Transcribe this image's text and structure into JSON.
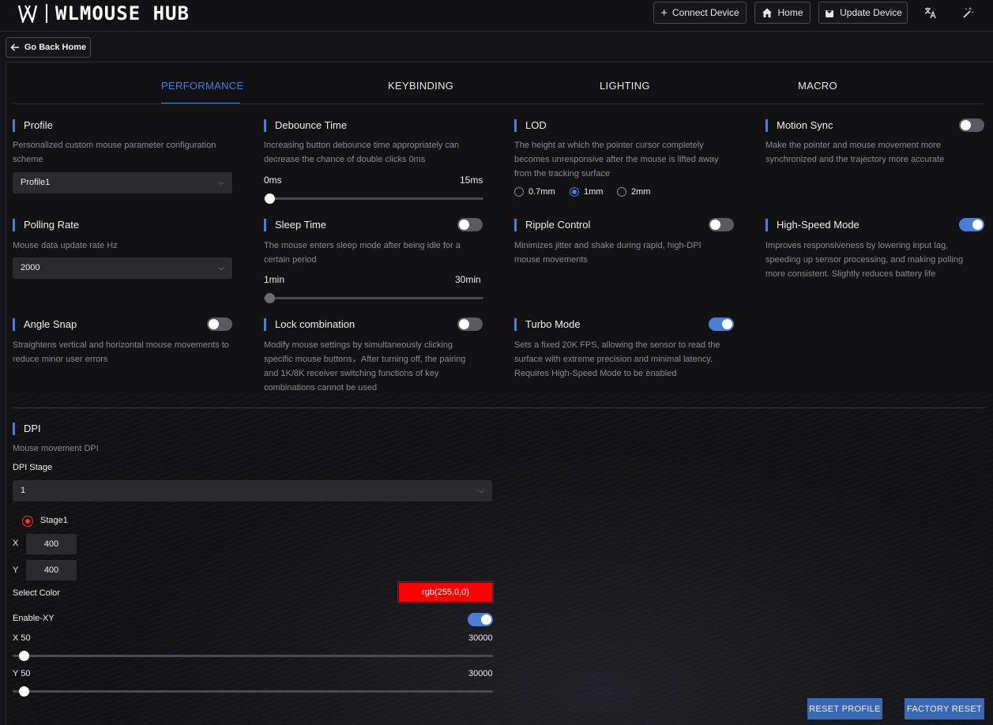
{
  "app": {
    "brand": "WLMOUSE HUB"
  },
  "toolbar": {
    "connect_device": "Connect Device",
    "home": "Home",
    "update_device": "Update Device"
  },
  "back_button": "Go Back Home",
  "tabs": [
    {
      "label": "PERFORMANCE",
      "active": true
    },
    {
      "label": "KEYBINDING",
      "active": false
    },
    {
      "label": "LIGHTING",
      "active": false
    },
    {
      "label": "MACRO",
      "active": false
    }
  ],
  "settings": {
    "profile": {
      "title": "Profile",
      "desc": "Personalized custom mouse parameter configuration scheme",
      "value": "Profile1"
    },
    "debounce": {
      "title": "Debounce Time",
      "desc": "Increasing button debounce time appropriately can decrease the chance of double clicks 0ms",
      "min": "0ms",
      "max": "15ms",
      "value": 0
    },
    "lod": {
      "title": "LOD",
      "desc": "The height at which the pointer cursor completely becomes unresponsive after the mouse is lifted away from the tracking surface",
      "options": [
        "0.7mm",
        "1mm",
        "2mm"
      ],
      "selected": "1mm"
    },
    "motion_sync": {
      "title": "Motion Sync",
      "desc": "Make the pointer and mouse movement more synchronized and the trajectory more accurate",
      "enabled": false
    },
    "polling_rate": {
      "title": "Polling Rate",
      "desc": "Mouse data update rate Hz",
      "value": "2000"
    },
    "sleep_time": {
      "title": "Sleep Time",
      "desc": "The mouse enters sleep mode after being idle for a certain period",
      "min": "1min",
      "max": "30min",
      "enabled": false
    },
    "ripple_control": {
      "title": "Ripple Control",
      "desc": "Minimizes jitter and shake during rapid, high-DPI mouse movements",
      "enabled": false
    },
    "high_speed": {
      "title": "High-Speed Mode",
      "desc": "Improves responsiveness by lowering input lag, speeding up sensor processing, and making polling more consistent. Slightly reduces battery life",
      "enabled": true
    },
    "angle_snap": {
      "title": "Angle Snap",
      "desc": "Straightens vertical and horizontal mouse movements to reduce minor user errors",
      "enabled": false
    },
    "lock_combination": {
      "title": "Lock combination",
      "desc": "Modify mouse settings by simultaneously clicking specific mouse buttons，After turning off, the pairing and 1K/8K receiver switching functions of key combinations cannot be used",
      "enabled": false
    },
    "turbo_mode": {
      "title": "Turbo Mode",
      "desc": "Sets a fixed 20K FPS, allowing the sensor to read the surface with extreme precision and minimal latency. Requires High-Speed Mode to be enabled",
      "enabled": true
    }
  },
  "dpi": {
    "title": "DPI",
    "desc": "Mouse movement DPI",
    "stage_label": "DPI Stage",
    "stage_value": "1",
    "stage_name": "Stage1",
    "x_label": "X",
    "x_value": "400",
    "y_label": "Y",
    "y_value": "400",
    "color_label": "Select Color",
    "color_value": "rgb(255,0,0)",
    "color_hex": "#ff0000",
    "enable_xy_label": "Enable-XY",
    "enable_xy": true,
    "x_slider_label": "X 50",
    "x_slider_max": "30000",
    "y_slider_label": "Y 50",
    "y_slider_max": "30000"
  },
  "actions": {
    "reset_profile": "RESET PROFILE",
    "factory_reset": "FACTORY RESET"
  },
  "colors": {
    "accent": "#4a7fd6",
    "background": "#141418",
    "button": "#3a68b5"
  }
}
